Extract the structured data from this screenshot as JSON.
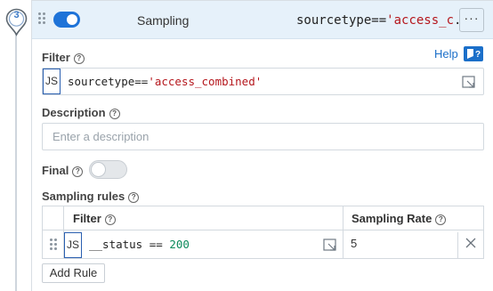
{
  "step": {
    "number": "3"
  },
  "header": {
    "title": "Sampling",
    "filter_prefix": "sourcetype==",
    "filter_string": "'access_c",
    "filter_ellipsis": "...",
    "more_label": "···",
    "enabled": true
  },
  "filter": {
    "label": "Filter",
    "help_link": "Help",
    "js_badge": "JS",
    "code_prefix": "sourcetype==",
    "code_string": "'access_combined'"
  },
  "description": {
    "label": "Description",
    "placeholder": "Enter a description",
    "value": ""
  },
  "final": {
    "label": "Final",
    "enabled": false
  },
  "sampling_rules": {
    "label": "Sampling rules",
    "columns": {
      "filter": "Filter",
      "rate": "Sampling Rate"
    },
    "rows": [
      {
        "js_badge": "JS",
        "expr_field": "__status",
        "expr_op": " == ",
        "expr_value": "200",
        "rate": "5"
      }
    ],
    "add_button": "Add Rule"
  },
  "colors": {
    "accent": "#1e73d8",
    "header_bg": "#e6f1fa",
    "string": "#b5171d",
    "number": "#0b8a5b",
    "link": "#1b6fc9"
  }
}
